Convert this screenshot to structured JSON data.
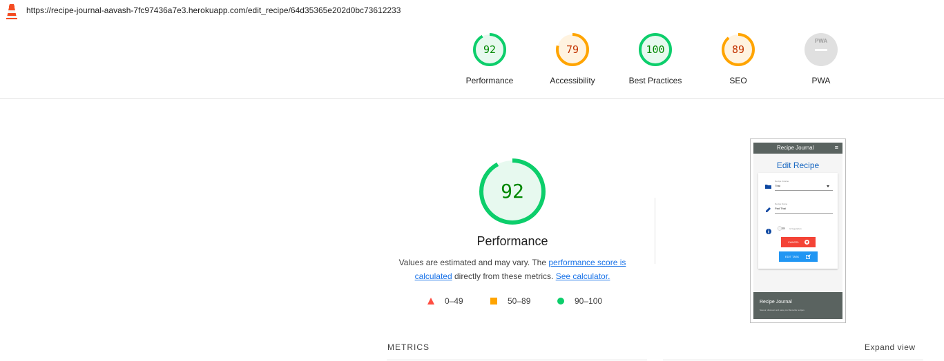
{
  "url_bar": {
    "url": "https://recipe-journal-aavash-7fc97436a7e3.herokuapp.com/edit_recipe/64d35365e202d0bc73612233"
  },
  "colors": {
    "pass": "#0cce6b",
    "average": "#ffa400",
    "fail": "#ff4e42",
    "na": "#e0e0e0",
    "link": "#1a73e8"
  },
  "summary": {
    "categories": [
      {
        "label": "Performance",
        "score": "92",
        "fraction": 0.92,
        "status": "pass"
      },
      {
        "label": "Accessibility",
        "score": "79",
        "fraction": 0.79,
        "status": "average"
      },
      {
        "label": "Best Practices",
        "score": "100",
        "fraction": 1.0,
        "status": "pass"
      },
      {
        "label": "SEO",
        "score": "89",
        "fraction": 0.89,
        "status": "average"
      },
      {
        "label": "PWA",
        "score": "PWA",
        "fraction": 0,
        "status": "na"
      }
    ]
  },
  "performance": {
    "score": "92",
    "fraction": 0.92,
    "title": "Performance",
    "desc_text1": "Values are estimated and may vary. The ",
    "desc_link1": "performance score is calculated",
    "desc_text2": " directly from these metrics. ",
    "desc_link2": "See calculator."
  },
  "legend": [
    {
      "icon": "triangle-icon",
      "range": "0–49"
    },
    {
      "icon": "square-icon",
      "range": "50–89"
    },
    {
      "icon": "circle-icon",
      "range": "90–100"
    }
  ],
  "screenshot": {
    "brand": "Recipe Journal",
    "menu_icon": "≡",
    "page_title": "Edit Recipe",
    "field1_label": "Recipe Cuisine",
    "field1_value": "Thai",
    "field2_label": "Recipe Name",
    "field2_value": "Pad Thai",
    "toggle_label": "Is Vegetarian",
    "cancel_label": "CANCEL",
    "edit_label": "EDIT TASK",
    "footer_title": "Recipe Journal",
    "footer_text": "Savour, discover and save your favourite recipes"
  },
  "metrics": {
    "title": "METRICS",
    "expand_label": "Expand view"
  }
}
